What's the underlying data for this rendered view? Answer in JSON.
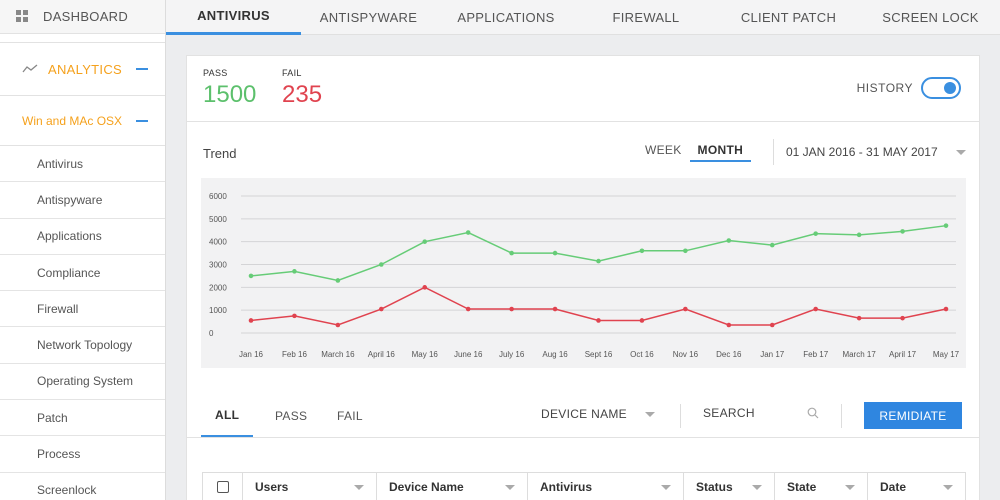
{
  "sidebar": {
    "dashboard": "DASHBOARD",
    "analytics": "ANALYTICS",
    "os_group": "Win and MAc OSX",
    "items": [
      "Antivirus",
      "Antispyware",
      "Applications",
      "Compliance",
      "Firewall",
      "Network Topology",
      "Operating System",
      "Patch",
      "Process",
      "Screenlock"
    ]
  },
  "top_tabs": [
    "ANTIVIRUS",
    "ANTISPYWARE",
    "APPLICATIONS",
    "FIREWALL",
    "CLIENT PATCH",
    "SCREEN LOCK"
  ],
  "summary": {
    "pass_label": "PASS",
    "pass_value": "1500",
    "fail_label": "FAIL",
    "fail_value": "235",
    "history_label": "HISTORY",
    "history_on": true
  },
  "trend": {
    "title": "Trend",
    "week_label": "WEEK",
    "month_label": "MONTH",
    "date_range": "01 JAN 2016 - 31 MAY 2017"
  },
  "chart_data": {
    "type": "line",
    "categories": [
      "Jan 16",
      "Feb 16",
      "March 16",
      "April 16",
      "May 16",
      "June 16",
      "July 16",
      "Aug 16",
      "Sept 16",
      "Oct 16",
      "Nov 16",
      "Dec 16",
      "Jan 17",
      "Feb 17",
      "March 17",
      "April 17",
      "May 17"
    ],
    "series": [
      {
        "color": "#66cc77",
        "values": [
          2500,
          2700,
          2300,
          3000,
          4000,
          4400,
          3500,
          3500,
          3150,
          3600,
          3600,
          4050,
          3850,
          4350,
          4300,
          4450,
          4700
        ]
      },
      {
        "color": "#e0434f",
        "values": [
          550,
          750,
          350,
          1050,
          2000,
          1050,
          1050,
          1050,
          550,
          550,
          1050,
          350,
          350,
          1050,
          650,
          650,
          1050
        ]
      }
    ],
    "yticks": [
      0,
      1000,
      2000,
      3000,
      4000,
      5000,
      6000
    ],
    "ylim": [
      0,
      6000
    ],
    "grid": true
  },
  "filter": {
    "tabs": [
      "ALL",
      "PASS",
      "FAIL"
    ],
    "device_name": "DEVICE NAME",
    "search_placeholder": "SEARCH",
    "remediate": "REMIDIATE"
  },
  "table": {
    "columns": [
      "Users",
      "Device Name",
      "Antivirus",
      "Status",
      "State",
      "Date"
    ]
  }
}
